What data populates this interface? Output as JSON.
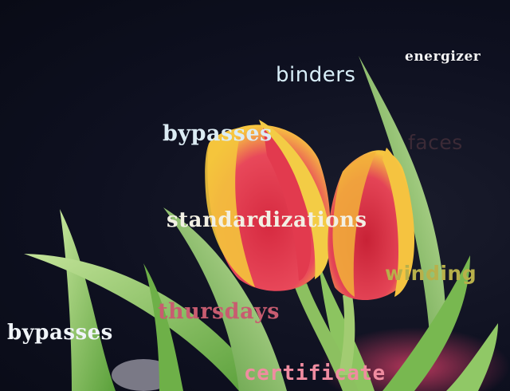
{
  "overlay_words": [
    {
      "id": "energizer",
      "text": "energizer",
      "color": "#f4f4f4"
    },
    {
      "id": "binders",
      "text": "binders",
      "color": "#d8eef8"
    },
    {
      "id": "bypasses-top",
      "text": "bypasses",
      "color": "#dcecf4"
    },
    {
      "id": "faces",
      "text": "faces",
      "color": "#3b2a36"
    },
    {
      "id": "standardizations",
      "text": "standardizations",
      "color": "#f2f0e4"
    },
    {
      "id": "winding",
      "text": "winding",
      "color": "#b8b04a"
    },
    {
      "id": "thursdays",
      "text": "thursdays",
      "color": "#c85c70"
    },
    {
      "id": "bypasses-left",
      "text": "bypasses",
      "color": "#f0f4f8"
    },
    {
      "id": "certificate",
      "text": "certificate",
      "color": "#f08ca0"
    }
  ],
  "colors": {
    "background": "#0e1020",
    "petal_red": "#e23a4e",
    "petal_yellow": "#f7d34a",
    "leaf_green": "#8cc860"
  }
}
